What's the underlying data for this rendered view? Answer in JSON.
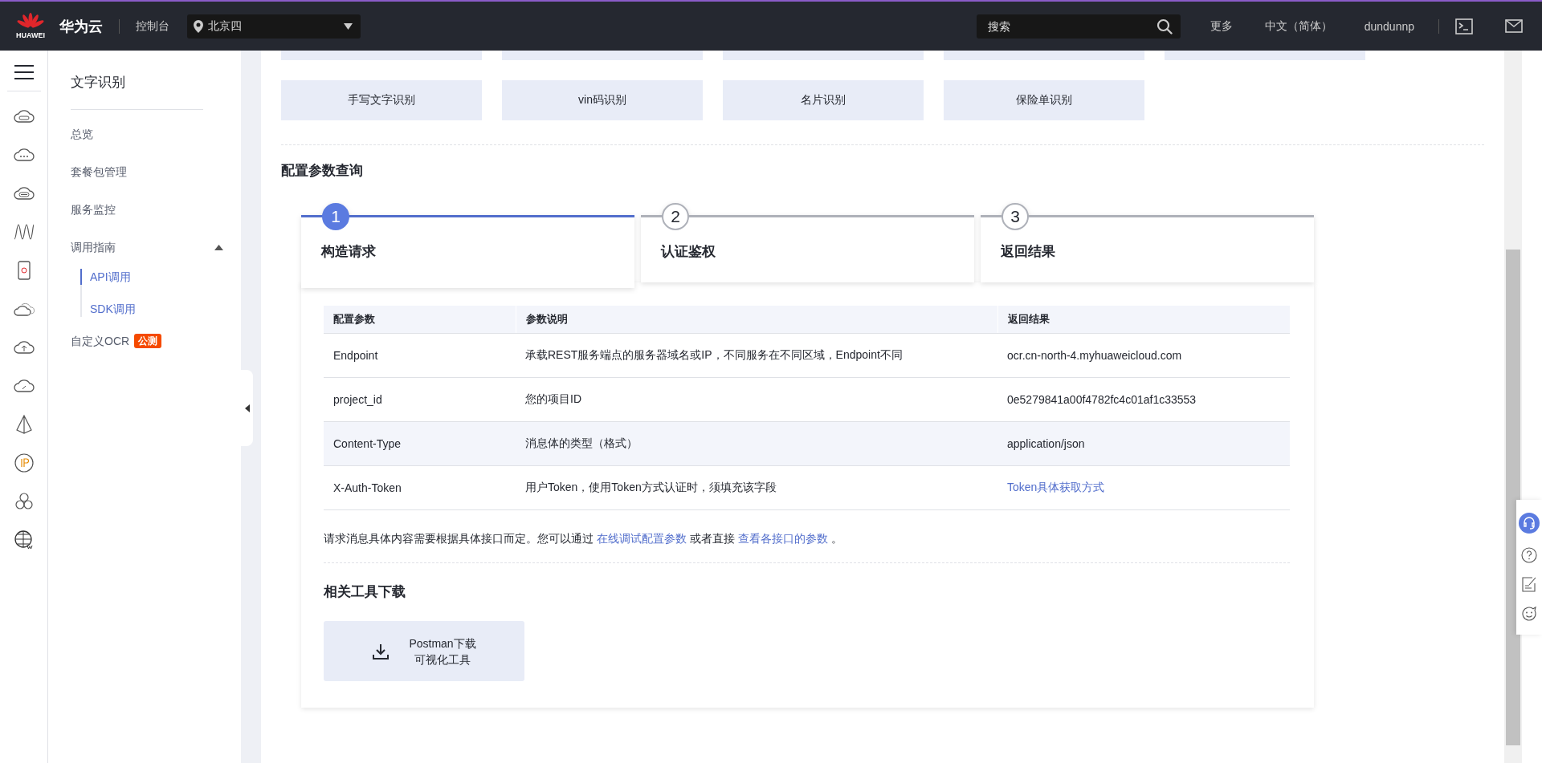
{
  "topbar": {
    "logo_text": "HUAWEI",
    "brand": "华为云",
    "console": "控制台",
    "region": "北京四",
    "search": {
      "placeholder": "搜索"
    },
    "more": "更多",
    "language": "中文（简体）",
    "user": "dundunnp"
  },
  "sidebar": {
    "title": "文字识别",
    "items": [
      {
        "label": "总览",
        "selected": false
      },
      {
        "label": "套餐包管理",
        "selected": false
      },
      {
        "label": "服务监控",
        "selected": false
      },
      {
        "label": "调用指南",
        "selected": false,
        "expanded": true,
        "children": [
          {
            "label": "API调用",
            "selected": true
          },
          {
            "label": "SDK调用",
            "selected": false
          }
        ]
      },
      {
        "label": "自定义OCR",
        "selected": false,
        "badge": "公测"
      }
    ]
  },
  "tiles_cut": [
    {
      "kind": "tile"
    },
    {
      "kind": "tile"
    },
    {
      "kind": "tile"
    },
    {
      "kind": "tile"
    },
    {
      "kind": "tile"
    }
  ],
  "tiles": [
    "手写文字识别",
    "vin码识别",
    "名片识别",
    "保险单识别"
  ],
  "section_title": "配置参数查询",
  "steps": [
    {
      "number": "1",
      "label": "构造请求",
      "selected": true
    },
    {
      "number": "2",
      "label": "认证鉴权",
      "selected": false
    },
    {
      "number": "3",
      "label": "返回结果",
      "selected": false
    }
  ],
  "table": {
    "columns": [
      "配置参数",
      "参数说明",
      "返回结果"
    ],
    "rows": [
      {
        "highlighted": false,
        "cells": [
          {
            "kind": "text",
            "text": "Endpoint"
          },
          {
            "kind": "text",
            "text": "承载REST服务端点的服务器域名或IP，不同服务在不同区域，Endpoint不同"
          },
          {
            "kind": "text",
            "text": "ocr.cn-north-4.myhuaweicloud.com"
          }
        ]
      },
      {
        "highlighted": false,
        "cells": [
          {
            "kind": "text",
            "text": "project_id"
          },
          {
            "kind": "text",
            "text": "您的项目ID"
          },
          {
            "kind": "text",
            "text": "0e5279841a00f4782fc4c01af1c33553"
          }
        ]
      },
      {
        "highlighted": true,
        "cells": [
          {
            "kind": "text",
            "text": "Content-Type"
          },
          {
            "kind": "text",
            "text": "消息体的类型（格式）"
          },
          {
            "kind": "text",
            "text": "application/json"
          }
        ]
      },
      {
        "highlighted": false,
        "cells": [
          {
            "kind": "text",
            "text": "X-Auth-Token"
          },
          {
            "kind": "text",
            "text": "用户Token，使用Token方式认证时，须填充该字段"
          },
          {
            "kind": "link",
            "text": "Token具体获取方式"
          }
        ]
      }
    ]
  },
  "note": [
    {
      "kind": "text",
      "text": "请求消息具体内容需要根据具体接口而定。您可以通过"
    },
    {
      "kind": "link",
      "text": "在线调试配置参数"
    },
    {
      "kind": "text",
      "text": "或者直接"
    },
    {
      "kind": "link",
      "text": "查看各接口的参数"
    },
    {
      "kind": "text",
      "text": "。"
    }
  ],
  "tools_title": "相关工具下载",
  "download": {
    "line1": "Postman下载",
    "line2": "可视化工具"
  }
}
